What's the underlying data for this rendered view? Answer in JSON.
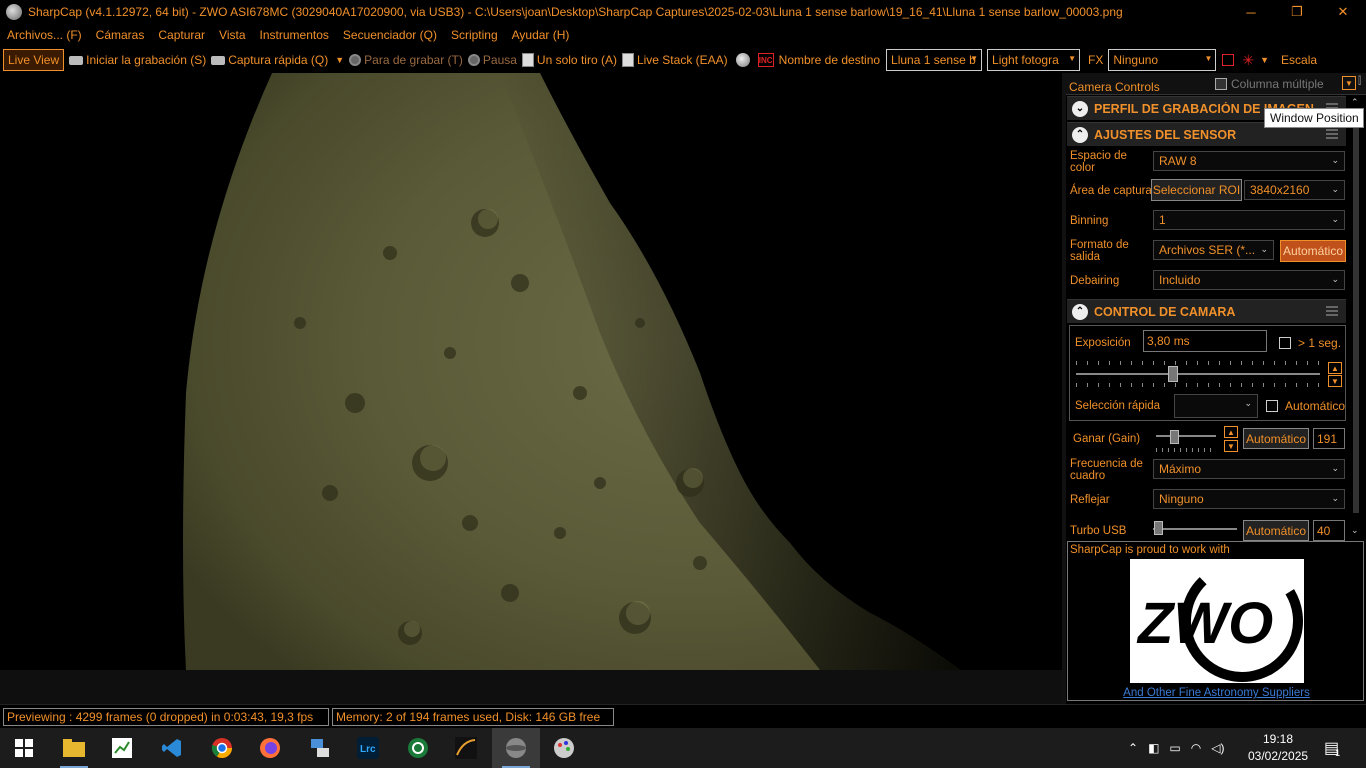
{
  "window": {
    "title": "SharpCap (v4.1.12972, 64 bit) - ZWO ASI678MC (3029040A17020900, via USB3) - C:\\Users\\joan\\Desktop\\SharpCap Captures\\2025-02-03\\Lluna 1 sense barlow\\19_16_41\\Lluna 1 sense barlow_00003.png",
    "minimize": "─",
    "maximize": "❐",
    "close": "✕"
  },
  "menu": [
    "Archivos... (F)",
    "Cámaras",
    "Capturar",
    "Vista",
    "Instrumentos",
    "Secuenciador (Q)",
    "Scripting",
    "Ayudar (H)"
  ],
  "toolbar": {
    "live_view": "Live View",
    "start_recording": "Iniciar la grabación (S)",
    "quick_capture": "Captura rápida (Q)",
    "stop_recording": "Para de grabar (T)",
    "pause": "Pausa",
    "single_shot": "Un solo tiro (A)",
    "live_stack": "Live Stack (EAA)",
    "target_name_label": "Nombre de destino",
    "target_name_value": "Lluna 1 sense b",
    "frame_type": "Light fotogra",
    "fx_label": "FX",
    "fx_value": "Ninguno",
    "scale_label": "Escala"
  },
  "panel": {
    "header": "Camera Controls",
    "multi_column": "Columna múltiple",
    "tooltip": "Window Position",
    "sections": {
      "profile": "PERFIL DE GRABACIÓN DE IMAGEN",
      "sensor": "AJUSTES DEL SENSOR",
      "camera": "CONTROL DE CAMARA"
    },
    "sensor": {
      "color_space_label": "Espacio de color",
      "color_space_value": "RAW 8",
      "capture_area_label": "Área de captura",
      "select_roi": "Seleccionar ROI",
      "resolution": "3840x2160",
      "binning_label": "Binning",
      "binning_value": "1",
      "output_format_label": "Formato de salida",
      "output_format_value": "Archivos SER (*...",
      "output_auto": "Automático",
      "debayer_label": "Debairing",
      "debayer_value": "Incluido"
    },
    "camera": {
      "exposure_label": "Exposición",
      "exposure_value": "3,80 ms",
      "long_exposure": "> 1 seg.",
      "quick_select_label": "Selección rápida",
      "quick_select_auto": "Automático",
      "gain_label": "Ganar (Gain)",
      "gain_auto": "Automático",
      "gain_value": "191",
      "frame_rate_label": "Frecuencia de cuadro",
      "frame_rate_value": "Máximo",
      "flip_label": "Reflejar",
      "flip_value": "Ninguno",
      "turbo_label": "Turbo USB",
      "turbo_auto": "Automático",
      "turbo_value": "40"
    },
    "sponsor": {
      "text": "SharpCap is proud to work with",
      "logo_text": "ZWO",
      "link": "And Other Fine Astronomy Suppliers"
    }
  },
  "status": {
    "preview": "Previewing : 4299 frames (0 dropped) in 0:03:43, 19,3 fps",
    "memory": "Memory: 2 of 194 frames used, Disk: 146 GB free"
  },
  "taskbar": {
    "time": "19:18",
    "date": "03/02/2025",
    "notifications": "1"
  },
  "colors": {
    "accent": "#f0902a",
    "background": "#000000",
    "active_button": "#c0511a"
  }
}
